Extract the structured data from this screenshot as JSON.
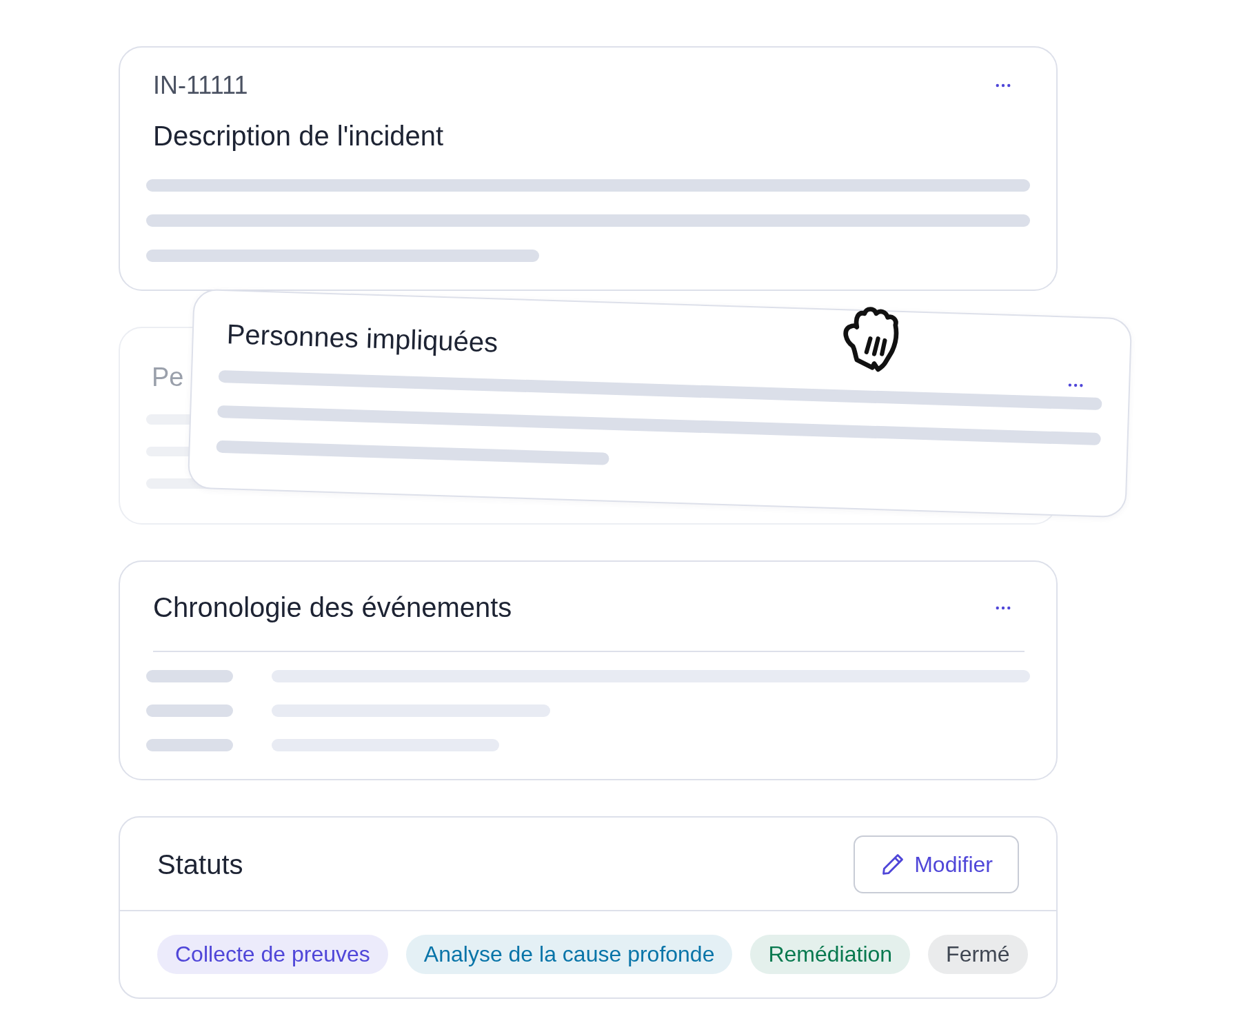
{
  "incident_card": {
    "reference": "IN-11111",
    "title": "Description de l'incident"
  },
  "people_card": {
    "ghost_title": "Pe",
    "dragged_title": "Personnes impliquées"
  },
  "timeline_card": {
    "title": "Chronologie des événements"
  },
  "status_card": {
    "title": "Statuts",
    "edit_button": "Modifier",
    "tags": [
      {
        "label": "Collecte de preuves",
        "color": "#4f46d8"
      },
      {
        "label": "Analyse de la cause profonde",
        "color": "#0874a8"
      },
      {
        "label": "Remédiation",
        "color": "#08794f"
      },
      {
        "label": "Fermé",
        "color": "#3f4652"
      }
    ]
  }
}
